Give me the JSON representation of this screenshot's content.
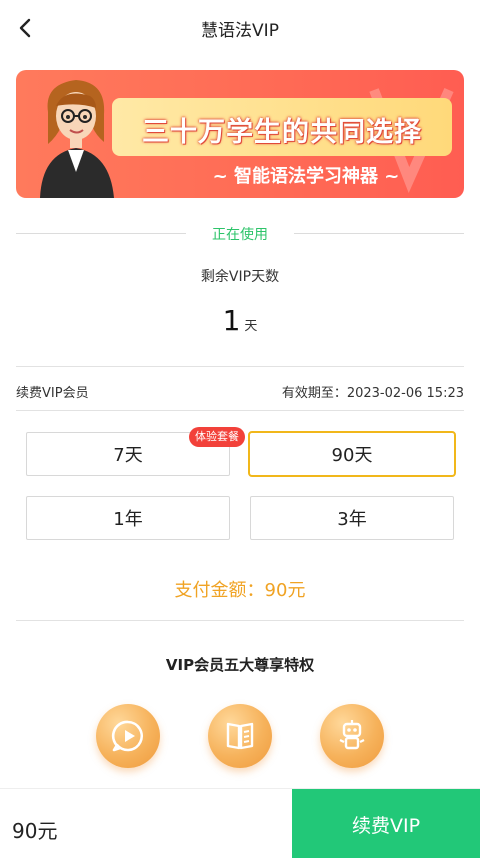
{
  "header": {
    "title": "慧语法VIP",
    "back_icon": "chevron-left-icon"
  },
  "banner": {
    "title": "三十万学生的共同选择",
    "subtitle": "~ 智能语法学习神器 ~",
    "colors": {
      "background": "#ff6a55",
      "pill": "#ffd97a"
    }
  },
  "status": {
    "label": "正在使用",
    "color": "#2ec46a"
  },
  "remaining": {
    "label": "剩余VIP天数",
    "value": "1",
    "unit": "天"
  },
  "renew": {
    "label": "续费VIP会员",
    "expiry": "有效期至：2023-02-06 15:23"
  },
  "plans": [
    {
      "label": "7天",
      "badge": "体验套餐",
      "selected": false
    },
    {
      "label": "90天",
      "selected": true
    },
    {
      "label": "1年",
      "selected": false
    },
    {
      "label": "3年",
      "selected": false
    }
  ],
  "payment": {
    "label": "支付金额：90元",
    "color": "#f0a324"
  },
  "privileges": {
    "title": "VIP会员五大尊享特权",
    "items": [
      {
        "icon": "play-video-icon",
        "label": ""
      },
      {
        "icon": "book-icon",
        "label": ""
      },
      {
        "icon": "robot-icon",
        "label": ""
      }
    ]
  },
  "bottom": {
    "price": "90元",
    "button_label": "续费VIP",
    "button_color": "#22c878"
  }
}
